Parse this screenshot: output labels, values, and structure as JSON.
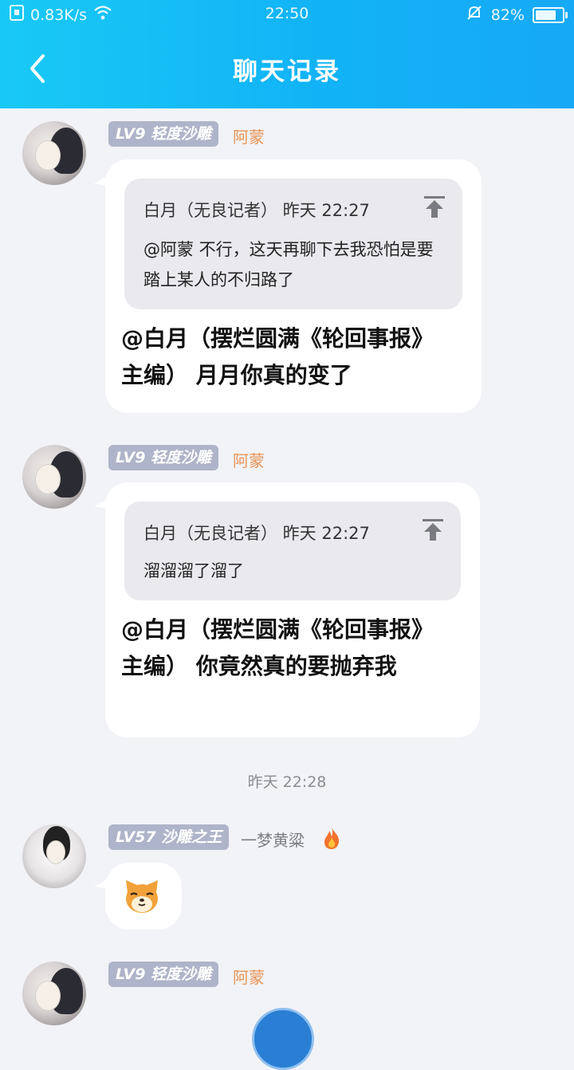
{
  "status_bar": {
    "speed": "0.83K/s",
    "time": "22:50",
    "battery": "82%",
    "battery_level": 0.82
  },
  "header": {
    "title": "聊天记录"
  },
  "messages": [
    {
      "level": "LV9",
      "title": "轻度沙雕",
      "nick": "阿蒙",
      "quote": {
        "meta": "白月（无良记者） 昨天 22:27",
        "text": "@阿蒙 不行，这天再聊下去我恐怕是要踏上某人的不归路了"
      },
      "text": "@白月（摆烂圆满《轮回事报》主编） 月月你真的变了"
    },
    {
      "level": "LV9",
      "title": "轻度沙雕",
      "nick": "阿蒙",
      "quote": {
        "meta": "白月（无良记者） 昨天 22:27",
        "text": "溜溜溜了溜了"
      },
      "text": "@白月（摆烂圆满《轮回事报》主编） 你竟然真的要抛弃我"
    },
    {
      "level": "LV57",
      "title": "沙雕之王",
      "nick": "一梦黄粱",
      "nick_icon": "fire-icon",
      "emoji": "dog-face-icon"
    },
    {
      "level": "LV9",
      "title": "轻度沙雕",
      "nick": "阿蒙"
    }
  ],
  "timestamp": "昨天 22:28",
  "colors": {
    "header": "#12b3f6",
    "badge": "#aeb4c9",
    "nick_orange": "#e89455"
  }
}
